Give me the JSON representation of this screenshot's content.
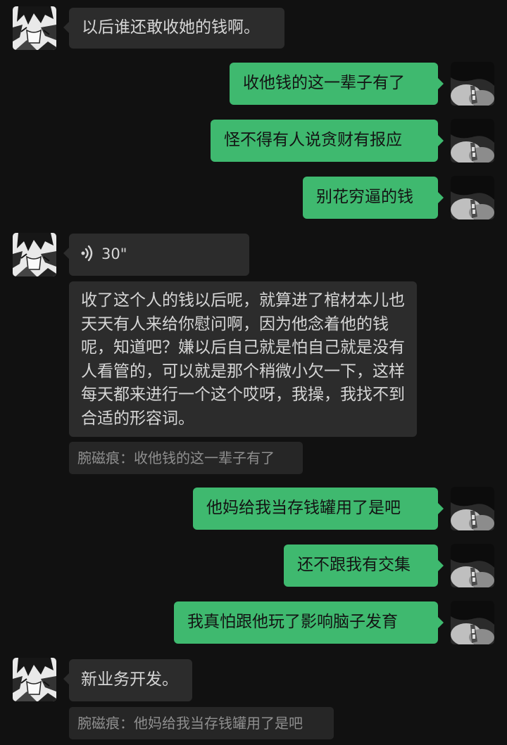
{
  "messages": [
    {
      "text": "以后谁还敢收她的钱啊。"
    },
    {
      "text": "收他钱的这一辈子有了"
    },
    {
      "text": "怪不得有人说贪财有报应"
    },
    {
      "text": "别花穷逼的钱"
    },
    {
      "voice_duration": "30\""
    },
    {
      "text": "收了这个人的钱以后呢，就算进了棺材本儿也天天有人来给你慰问啊，因为他念着他的钱呢，知道吧？嫌以后自己就是怕自己就是没有人看管的，可以就是那个稍微小欠一下，这样每天都来进行一个这个哎呀，我操，我找不到合适的形容词。"
    },
    {
      "quote": "腕磁痕：收他钱的这一辈子有了"
    },
    {
      "text": "他妈给我当存钱罐用了是吧"
    },
    {
      "text": "还不跟我有交集"
    },
    {
      "text": "我真怕跟他玩了影响脑子发育"
    },
    {
      "text": "新业务开发。"
    },
    {
      "quote": "腕磁痕：他妈给我当存钱罐用了是吧"
    }
  ],
  "colors": {
    "background": "#111111",
    "incoming_bubble": "#2c2c2c",
    "outgoing_bubble": "#3fb96f",
    "quote_bg": "#262626"
  },
  "icons": {
    "voice": "voice-wave-icon",
    "avatar_left": "manga-avatar",
    "avatar_right": "dark-avatar"
  }
}
